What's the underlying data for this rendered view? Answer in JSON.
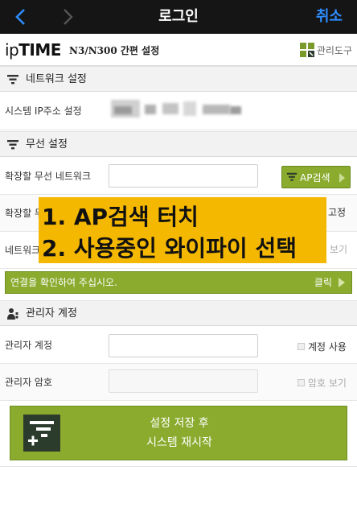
{
  "nav": {
    "title": "로그인",
    "cancel_label": "취소",
    "back_icon": "chevron-left-icon",
    "forward_icon": "chevron-right-icon",
    "accent_color": "#2e8cff"
  },
  "brand": {
    "logo_prefix": "ip",
    "logo_main": "TIME",
    "subtitle": "N3/N300 간편 설정",
    "tool_label": "관리도구",
    "tool_icon": "management-tools-icon"
  },
  "sections": {
    "network": {
      "label": "네트워크 설정",
      "icon": "filter-icon"
    },
    "wireless": {
      "label": "무선 설정",
      "icon": "filter-icon"
    },
    "admin": {
      "label": "관리자 계정",
      "icon": "admin-user-icon"
    }
  },
  "network": {
    "ip_label": "시스템 IP주소 설정"
  },
  "wireless": {
    "extend_label": "확장할 무선 네트워크",
    "extend_value": "",
    "ap_search_label": "AP검색",
    "row2_label": "확장할 무",
    "row2_side": "고정",
    "row3_label": "네트워크",
    "row3_side": "보기"
  },
  "overlay": {
    "line1": "1. AP검색 터치",
    "line2": "2. 사용중인 와이파이 선택",
    "color": "#f5b800"
  },
  "connect": {
    "message": "연결을 확인하여 주십시오.",
    "click_label": "클릭"
  },
  "admin": {
    "account_label": "관리자 계정",
    "account_value": "",
    "account_option": "계정 사용",
    "password_label": "관리자 암호",
    "password_value": "",
    "password_option": "암호 보기"
  },
  "save": {
    "line1": "설정 저장 후",
    "line2": "시스템 재시작",
    "icon": "save-settings-icon",
    "color": "#8aab2e"
  }
}
